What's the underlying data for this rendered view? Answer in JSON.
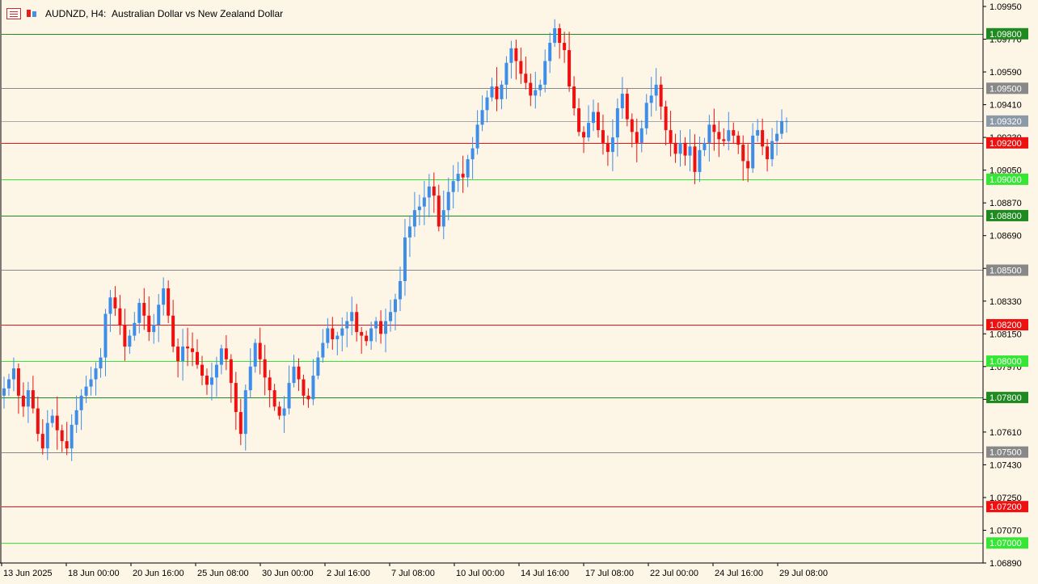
{
  "header": {
    "symbol": "AUDNZD",
    "timeframe": "H4:",
    "description": "Australian Dollar vs New Zealand Dollar",
    "menu_icon": "chart-menu-icon",
    "type_icon": "candlestick-icon"
  },
  "colors": {
    "background": "#fdf5e6",
    "bull": "#3d8ee8",
    "bear": "#ee1111",
    "axis": "#000000",
    "green_dark": "#1f8a1f",
    "green_light": "#35e635",
    "red": "#ee1111",
    "gray": "#888888"
  },
  "chart_data": {
    "type": "candlestick",
    "title": "AUDNZD, H4:  Australian Dollar vs New Zealand Dollar",
    "ylim": [
      1.0684,
      1.0999
    ],
    "grid": false,
    "price_axis_labels": [
      "1.09950",
      "1.09770",
      "1.09590",
      "1.09410",
      "1.09230",
      "1.09050",
      "1.08870",
      "1.08690",
      "1.08510",
      "1.08330",
      "1.08150",
      "1.07970",
      "1.07790",
      "1.07610",
      "1.07430",
      "1.07250",
      "1.07070",
      "1.06890"
    ],
    "time_axis_labels": [
      "13 Jun 2025",
      "18 Jun 00:00",
      "20 Jun 16:00",
      "25 Jun 08:00",
      "30 Jun 00:00",
      "2 Jul 16:00",
      "7 Jul 08:00",
      "10 Jul 00:00",
      "14 Jul 16:00",
      "17 Jul 08:00",
      "22 Jul 00:00",
      "24 Jul 16:00",
      "29 Jul 08:00"
    ],
    "levels": [
      {
        "price": 1.098,
        "label": "1.09800",
        "color": "#1f8a1f"
      },
      {
        "price": 1.095,
        "label": "1.09500",
        "color": "#888888"
      },
      {
        "price": 1.0932,
        "label": "1.09320",
        "color": "#a9a9a9",
        "current": true
      },
      {
        "price": 1.092,
        "label": "1.09200",
        "color": "#ee1111"
      },
      {
        "price": 1.09,
        "label": "1.09000",
        "color": "#35e635"
      },
      {
        "price": 1.088,
        "label": "1.08800",
        "color": "#1f8a1f"
      },
      {
        "price": 1.085,
        "label": "1.08500",
        "color": "#888888"
      },
      {
        "price": 1.082,
        "label": "1.08200",
        "color": "#ee1111"
      },
      {
        "price": 1.08,
        "label": "1.08000",
        "color": "#35e635"
      },
      {
        "price": 1.078,
        "label": "1.07800",
        "color": "#1f8a1f"
      },
      {
        "price": 1.075,
        "label": "1.07500",
        "color": "#888888"
      },
      {
        "price": 1.072,
        "label": "1.07200",
        "color": "#ee1111"
      },
      {
        "price": 1.07,
        "label": "1.07000",
        "color": "#35e635"
      }
    ],
    "series_close": [
      1.0785,
      1.079,
      1.0796,
      1.0781,
      1.0775,
      1.0784,
      1.0774,
      1.076,
      1.0752,
      1.0766,
      1.077,
      1.0762,
      1.0756,
      1.0752,
      1.0765,
      1.0773,
      1.0781,
      1.0786,
      1.079,
      1.0796,
      1.0802,
      1.0826,
      1.0835,
      1.0829,
      1.082,
      1.0808,
      1.0814,
      1.0821,
      1.0832,
      1.0825,
      1.0816,
      1.082,
      1.0831,
      1.084,
      1.0825,
      1.0808,
      1.08,
      1.0808,
      1.0807,
      1.0805,
      1.0798,
      1.0792,
      1.0787,
      1.0791,
      1.0798,
      1.0807,
      1.0801,
      1.0788,
      1.0772,
      1.076,
      1.0784,
      1.0797,
      1.081,
      1.0801,
      1.0791,
      1.0784,
      1.0775,
      1.077,
      1.0774,
      1.0788,
      1.0797,
      1.079,
      1.0781,
      1.0779,
      1.0792,
      1.0802,
      1.081,
      1.0818,
      1.0812,
      1.0814,
      1.0818,
      1.0822,
      1.0827,
      1.0816,
      1.0814,
      1.0811,
      1.0818,
      1.0822,
      1.0815,
      1.0822,
      1.0827,
      1.0834,
      1.0844,
      1.0868,
      1.0874,
      1.0883,
      1.0885,
      1.089,
      1.0896,
      1.0891,
      1.0874,
      1.0883,
      1.0893,
      1.0899,
      1.0903,
      1.0901,
      1.0911,
      1.0917,
      1.093,
      1.0938,
      1.0945,
      1.0951,
      1.0944,
      1.0952,
      1.0964,
      1.0972,
      1.0965,
      1.0958,
      1.0953,
      1.0946,
      1.0949,
      1.0952,
      1.0965,
      1.0975,
      1.0983,
      1.0975,
      1.0971,
      1.0951,
      1.0939,
      1.0926,
      1.0923,
      1.0931,
      1.0937,
      1.0927,
      1.092,
      1.0915,
      1.0923,
      1.0939,
      1.0947,
      1.0933,
      1.0926,
      1.092,
      1.0928,
      1.0942,
      1.0946,
      1.0952,
      1.094,
      1.0927,
      1.092,
      1.0914,
      1.092,
      1.0913,
      1.0918,
      1.0904,
      1.0916,
      1.092,
      1.093,
      1.0926,
      1.0922,
      1.0921,
      1.0927,
      1.0924,
      1.0919,
      1.091,
      1.0906,
      1.0924,
      1.0927,
      1.0918,
      1.0911,
      1.0921,
      1.0925,
      1.0932,
      1.0932
    ],
    "price_unit": "NZD"
  }
}
